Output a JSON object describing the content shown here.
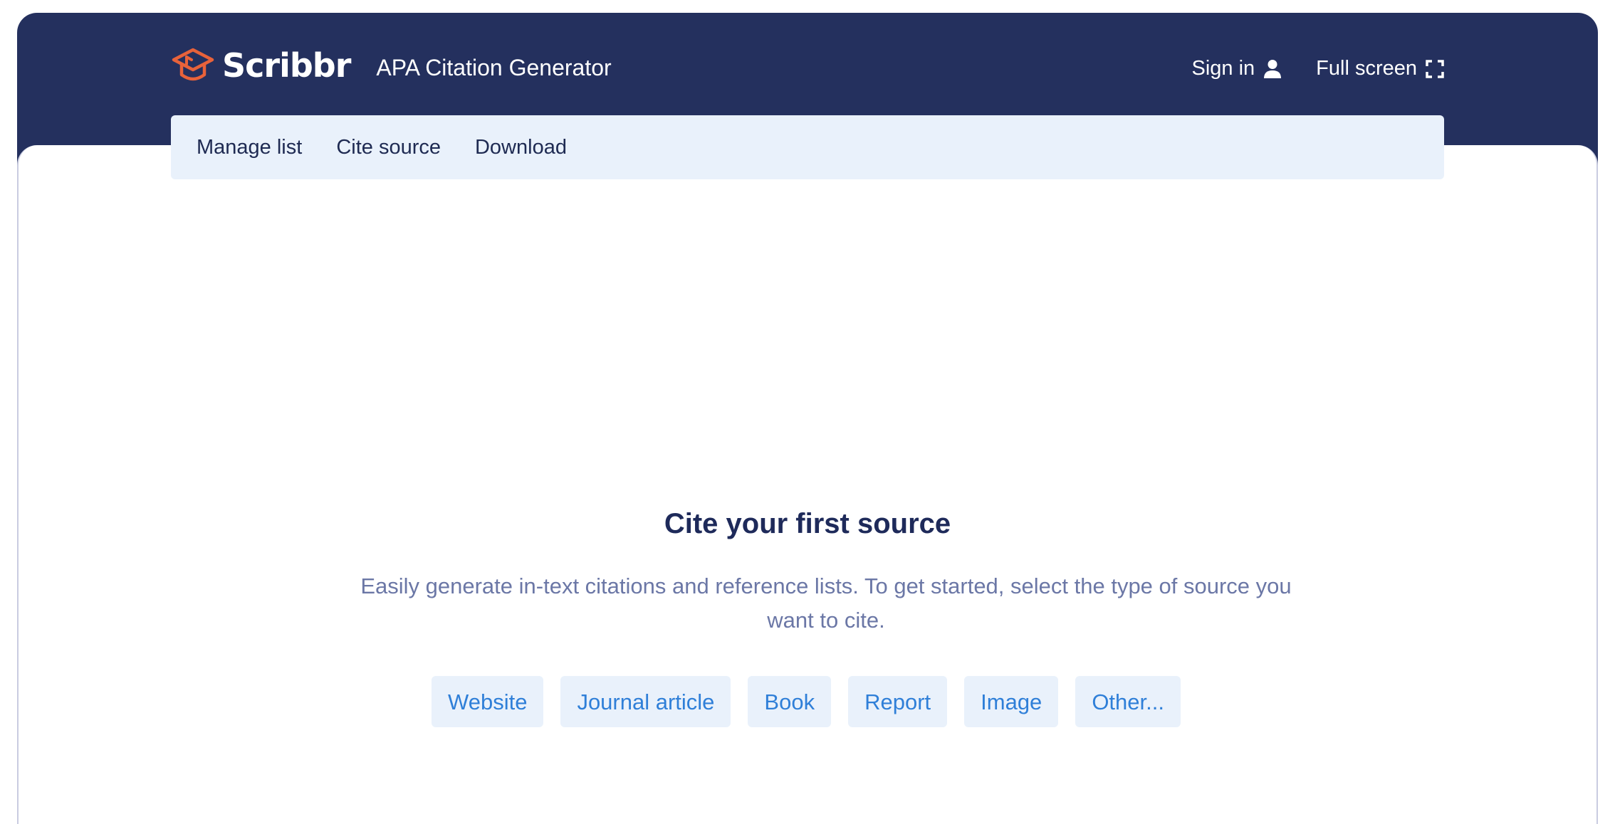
{
  "header": {
    "brand_name": "Scribbr",
    "app_title": "APA Citation Generator",
    "sign_in_label": "Sign in",
    "full_screen_label": "Full screen"
  },
  "tabs": [
    {
      "label": "Manage list"
    },
    {
      "label": "Cite source"
    },
    {
      "label": "Download"
    }
  ],
  "empty_state": {
    "title": "Cite your first source",
    "description": "Easily generate in-text citations and reference lists. To get started, select the type of source you want to cite."
  },
  "source_types": [
    {
      "label": "Website"
    },
    {
      "label": "Journal article"
    },
    {
      "label": "Book"
    },
    {
      "label": "Report"
    },
    {
      "label": "Image"
    },
    {
      "label": "Other..."
    }
  ],
  "icons": {
    "logo": "graduation-cap-icon",
    "sign_in": "user-icon",
    "full_screen": "expand-icon"
  },
  "colors": {
    "header_background": "#24305e",
    "logo_accent": "#e8623a",
    "tabbar_background": "#e9f1fb",
    "button_text": "#2f7fd8",
    "title_text": "#1e2a5a",
    "description_text": "#6b77a6"
  }
}
